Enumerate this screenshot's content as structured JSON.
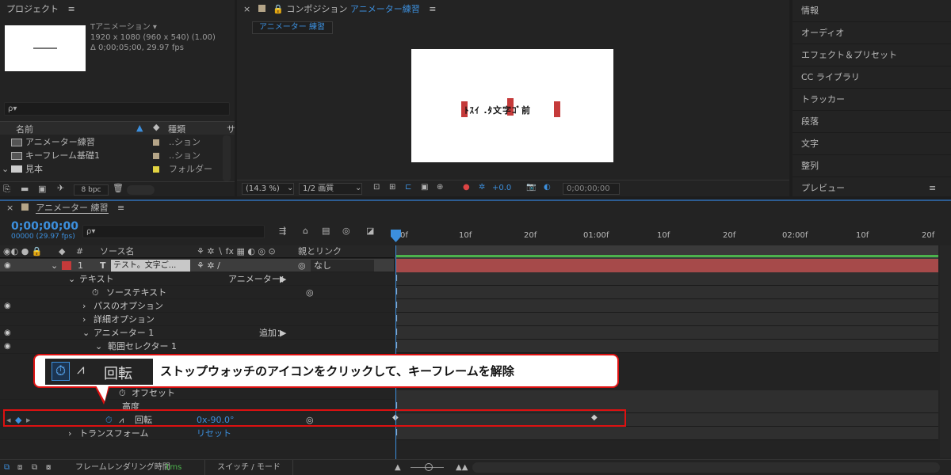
{
  "project": {
    "title": "プロジェクト",
    "menu": "≡",
    "comp_name": "Tアニメーション ▾",
    "comp_size": "1920 x 1080  (960 x 540) (1.00)",
    "comp_duration": "Δ 0;00;05;00, 29.97 fps",
    "search_placeholder": "ρ▾",
    "col_name": "名前",
    "col_type": "種類",
    "col_extra": "サ",
    "items": [
      {
        "name": "アニメーター練習",
        "type": "..ション",
        "color": "#b5a588"
      },
      {
        "name": "キーフレーム基礎1",
        "type": "..ション",
        "color": "#b5a588"
      },
      {
        "name": "見本",
        "type": "フォルダー",
        "color": "#e3d442"
      }
    ],
    "bpc": "8 bpc"
  },
  "composition": {
    "title_prefix": "コンポジション",
    "title_name": "アニメーター練習",
    "menu": "≡",
    "tab": "アニメーター 練習",
    "canvas_text": "ﾄｽｲ .ﾀ文字ｺﾞ前",
    "zoom": "(14.3 %)",
    "resolution": "1/2 画質",
    "exposure": "+0.0",
    "timecode": "0;00;00;00"
  },
  "right_panel": {
    "items": [
      "情報",
      "オーディオ",
      "エフェクト＆プリセット",
      "CC ライブラリ",
      "トラッカー",
      "段落",
      "文字",
      "整列",
      "プレビュー"
    ],
    "menu": "≡"
  },
  "timeline": {
    "tab": "アニメーター 練習",
    "menu": "≡",
    "timecode": "0;00;00;00",
    "fps": "00000 (29.97 fps)",
    "search_placeholder": "ρ▾",
    "col_source": "ソース名",
    "col_parent": "親とリンク",
    "col_hash": "#",
    "ruler": [
      "0f",
      "10f",
      "20f",
      "01:00f",
      "10f",
      "20f",
      "02:00f",
      "10f",
      "20f"
    ],
    "layer": {
      "num": "1",
      "type_icon": "T",
      "name": "テスト。文字ご...",
      "parent": "なし",
      "color": "#c53a3a"
    },
    "rows": {
      "text": "テキスト",
      "animator_menu": "アニメーター：",
      "source_text": "ソーステキスト",
      "path_options": "パスのオプション",
      "more_options": "詳細オプション",
      "animator1": "アニメーター 1",
      "add": "追加：",
      "range_selector": "範囲セレクター 1",
      "offset": "オフセット",
      "height": "高度",
      "rotation": "回転",
      "rotation_value": "0x-90.0°",
      "transform": "トランスフォーム",
      "reset": "リセット"
    },
    "footer": {
      "render_label": "フレームレンダリング時間",
      "render_value": "1ms",
      "switch_mode": "スイッチ / モード"
    }
  },
  "callout": {
    "icon_label": "回転",
    "text": "ストップウォッチのアイコンをクリックして、キーフレームを解除"
  },
  "colors": {
    "accent": "#3c8fdd",
    "highlight": "#dd1111",
    "layer_bar": "#a64a4a"
  }
}
